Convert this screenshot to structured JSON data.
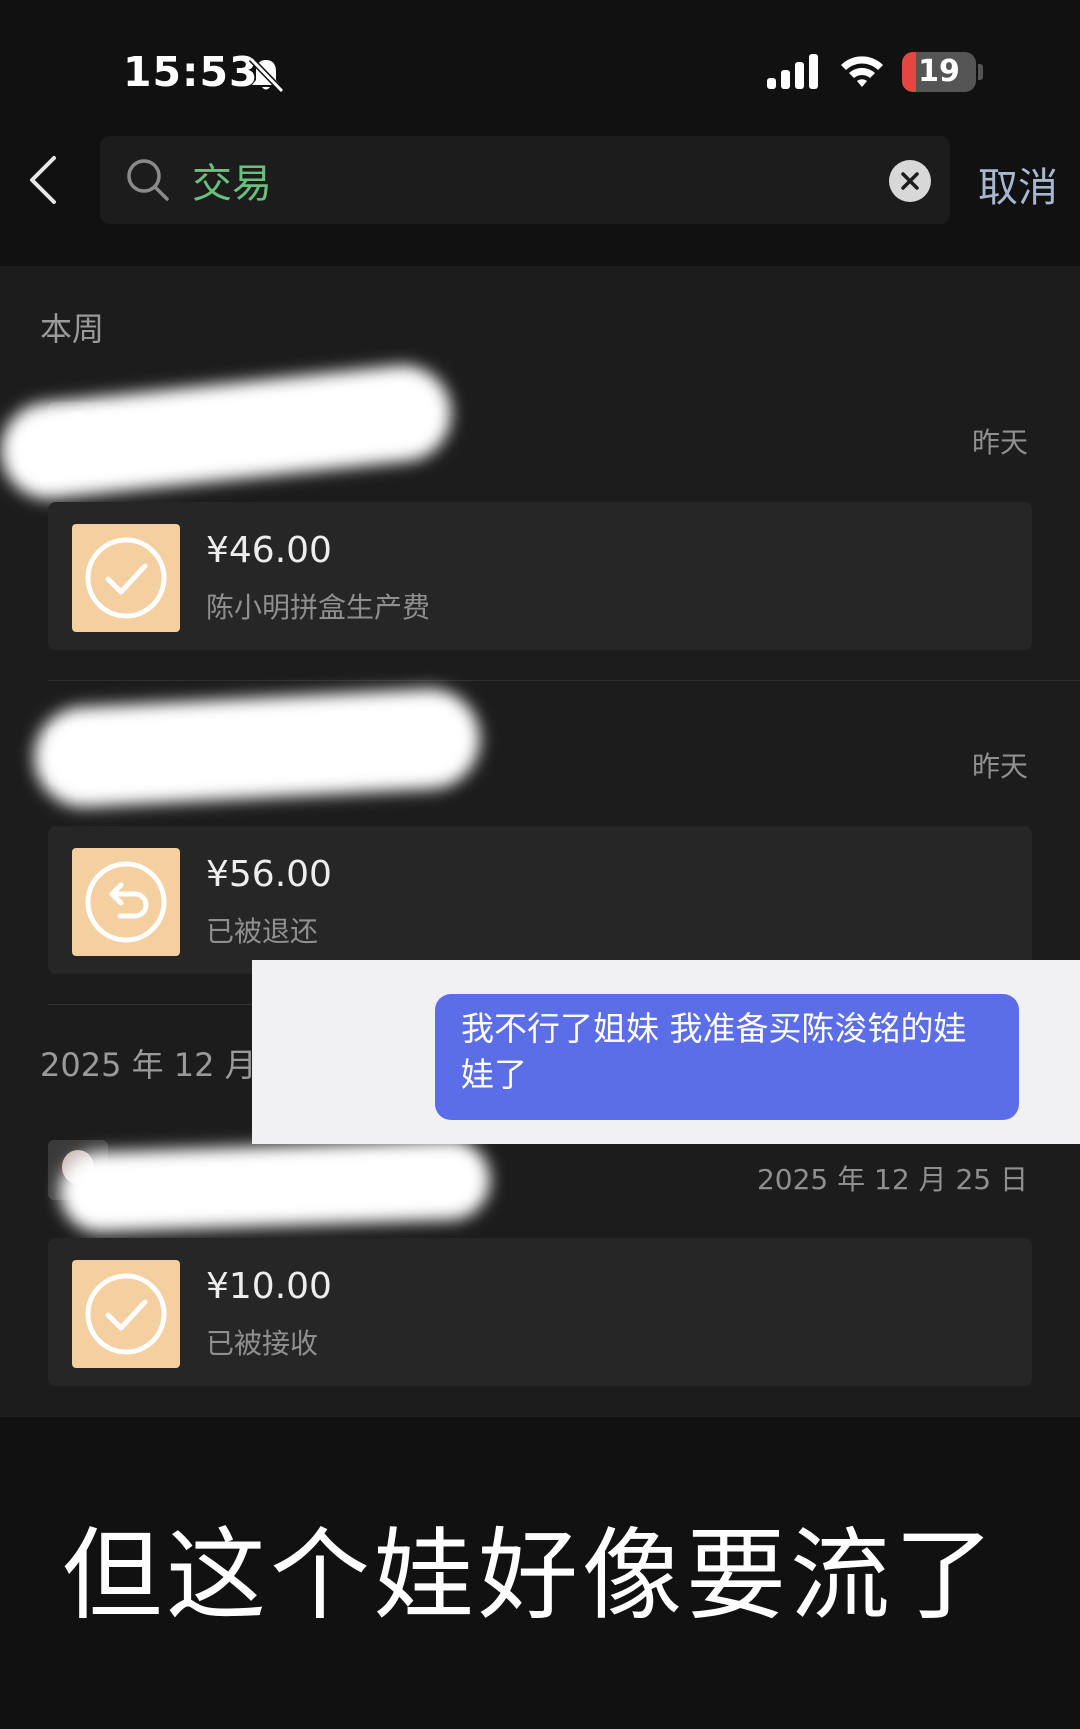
{
  "status_bar": {
    "time": "15:53",
    "battery": "19",
    "battery_level": 0.19
  },
  "search": {
    "query": "交易",
    "cancel_label": "取消"
  },
  "sections": [
    {
      "label": "本周",
      "transactions": [
        {
          "date": "昨天",
          "amount": "¥46.00",
          "desc": "陈小明拼盒生产费",
          "icon": "checkmark-icon"
        },
        {
          "date": "昨天",
          "amount": "¥56.00",
          "desc": "已被退还",
          "icon": "return-arrow-icon"
        }
      ]
    },
    {
      "label": "2025 年 12 月",
      "transactions": [
        {
          "date": "2025 年 12 月 25 日",
          "amount": "¥10.00",
          "desc": "已被接收",
          "icon": "checkmark-icon"
        }
      ]
    }
  ],
  "chat_overlay": {
    "message": "我不行了姐妹 我准备买陈浚铭的娃娃了"
  },
  "caption": "但这个娃好像要流了",
  "colors": {
    "background": "#111111",
    "panel": "#1c1c1c",
    "card": "#262626",
    "transfer_icon": "#f4cf9f",
    "search_text": "#69c07d",
    "cancel_text": "#a7b7cf",
    "chat_bubble": "#5b6ee8",
    "battery_low": "#e5463f"
  }
}
